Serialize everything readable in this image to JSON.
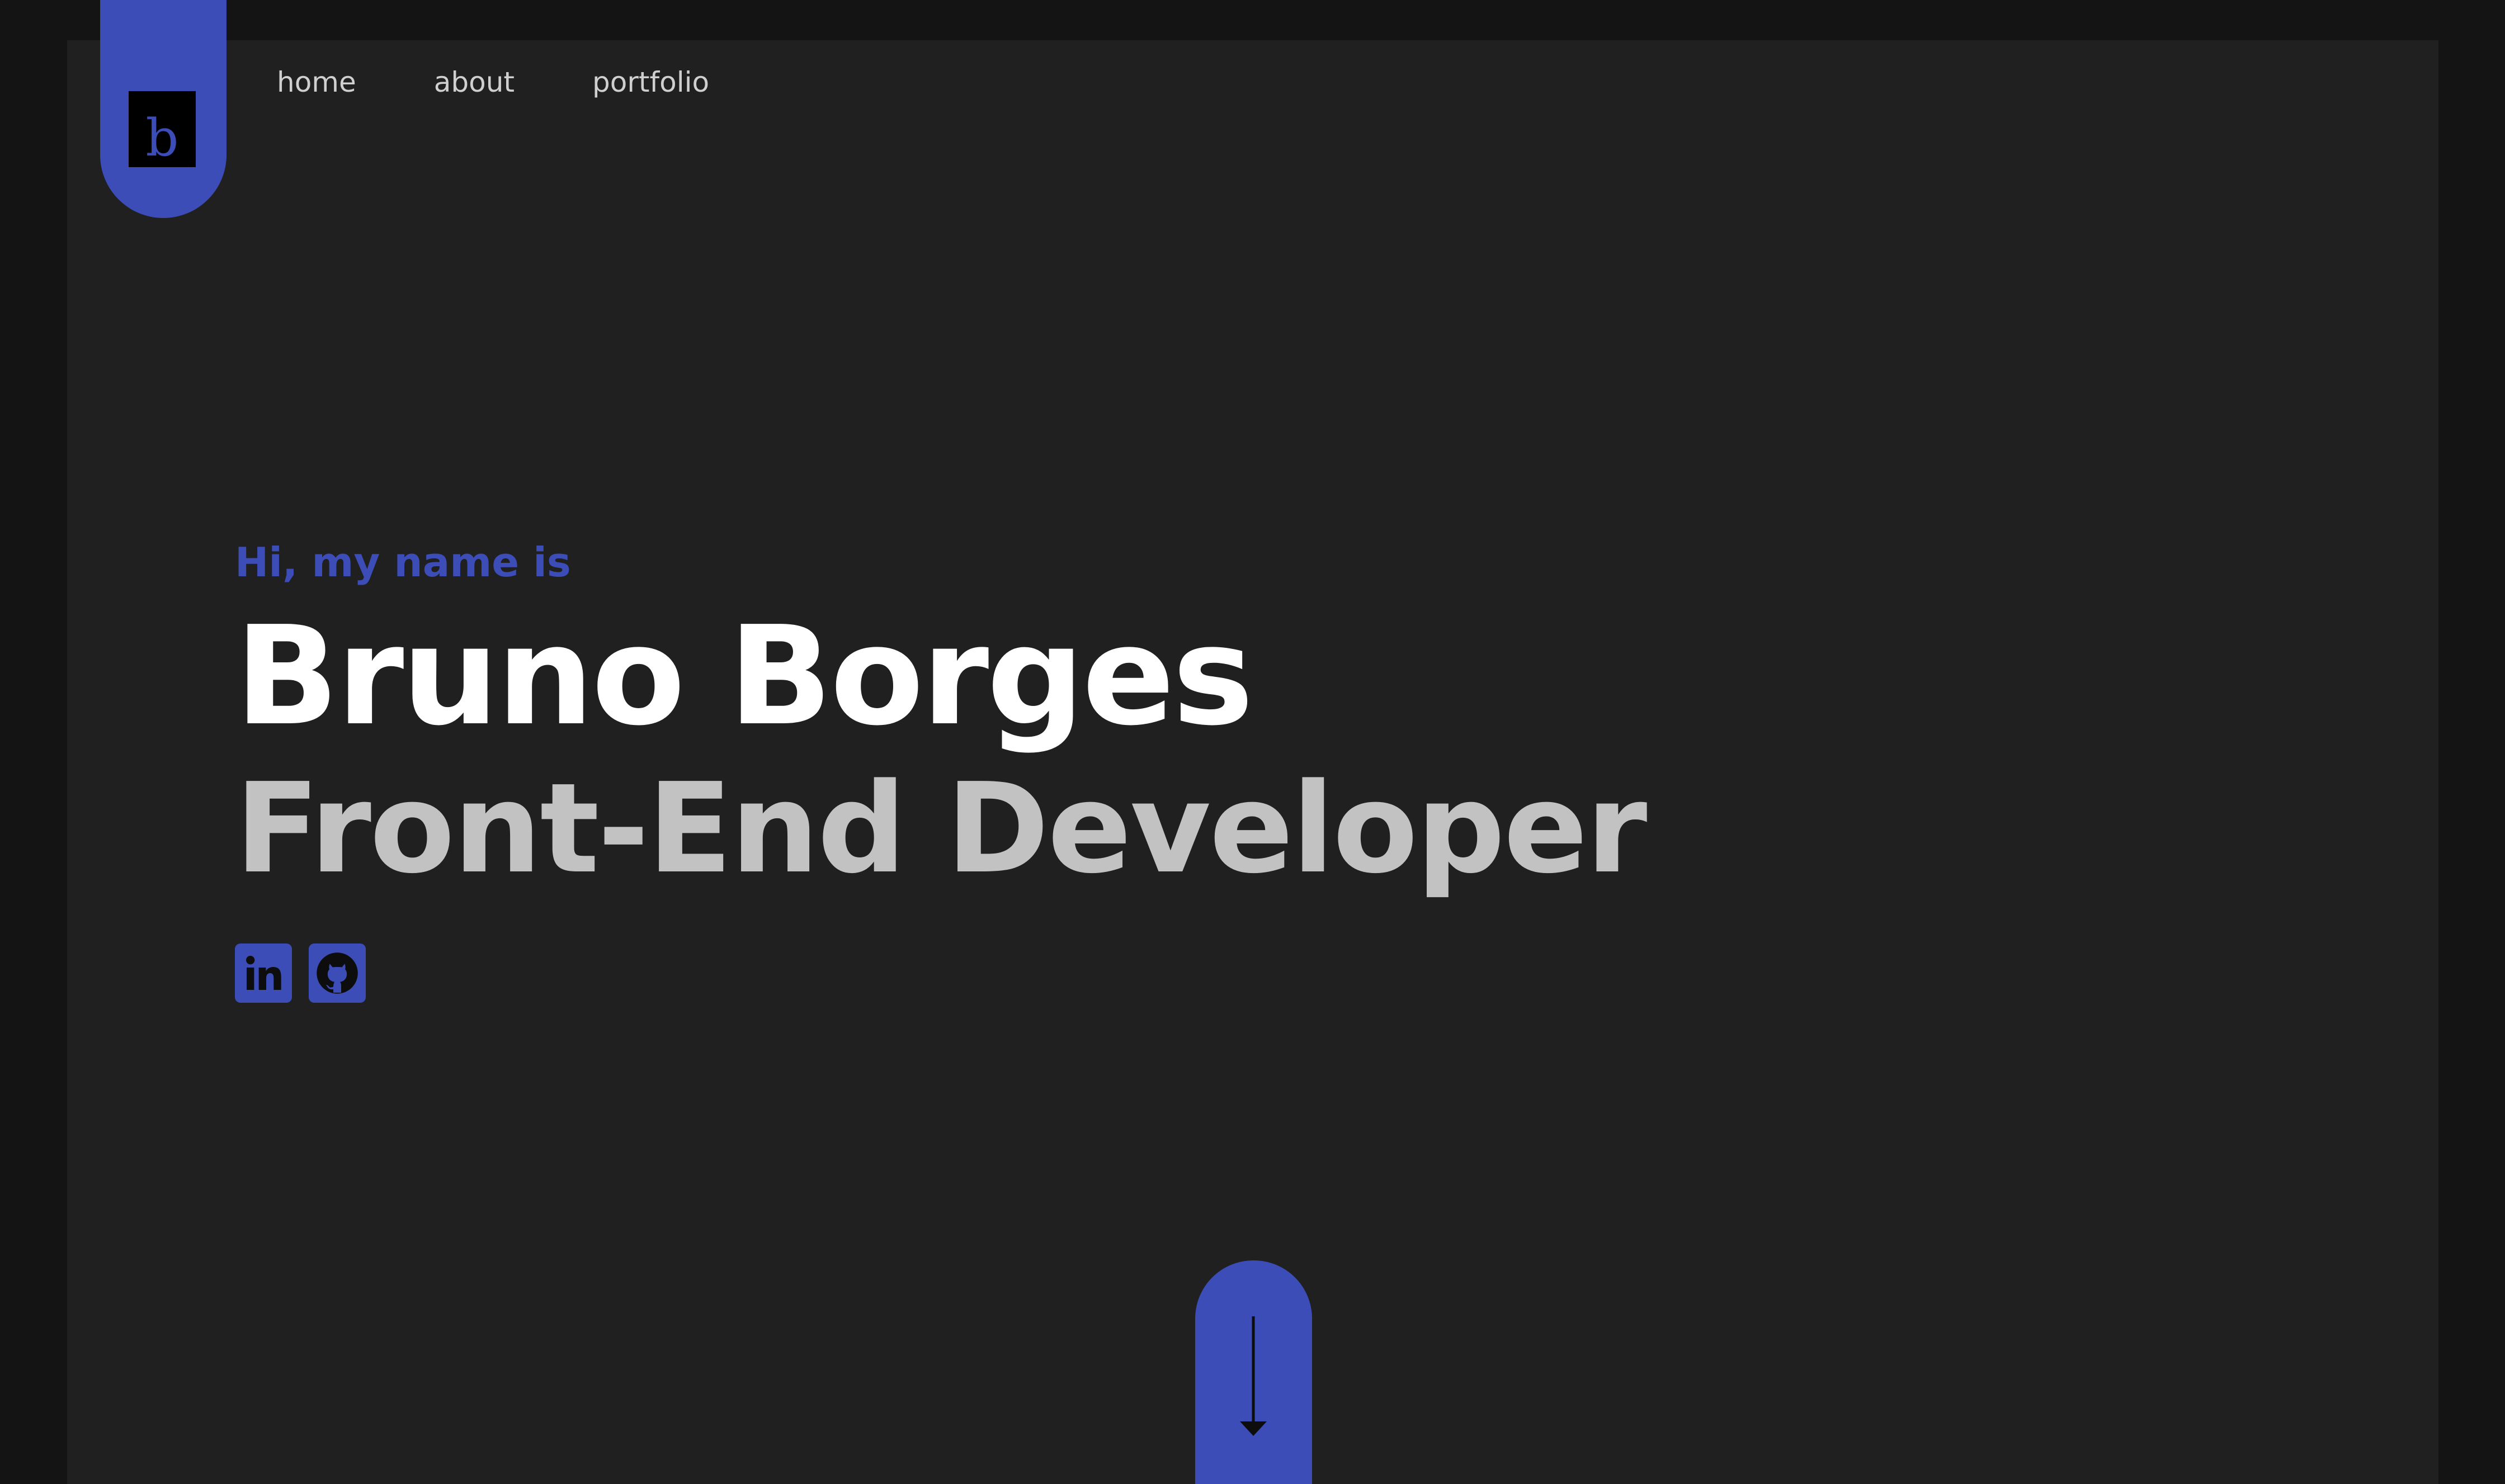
{
  "logo": {
    "letter": "b"
  },
  "nav": {
    "items": [
      {
        "label": "home"
      },
      {
        "label": "about"
      },
      {
        "label": "portfolio"
      }
    ]
  },
  "hero": {
    "greeting": "Hi, my name is",
    "name": "Bruno Borges",
    "role": "Front-End Developer"
  },
  "socials": [
    {
      "icon": "linkedin-icon"
    },
    {
      "icon": "github-icon"
    }
  ],
  "scroll": {
    "icon": "arrow-down-icon"
  },
  "colors": {
    "accent": "#3d4db8",
    "background": "#141414",
    "panel": "#202020",
    "name_text": "#ffffff",
    "role_text": "#c2c2c2",
    "nav_text": "#cfcfcf"
  }
}
